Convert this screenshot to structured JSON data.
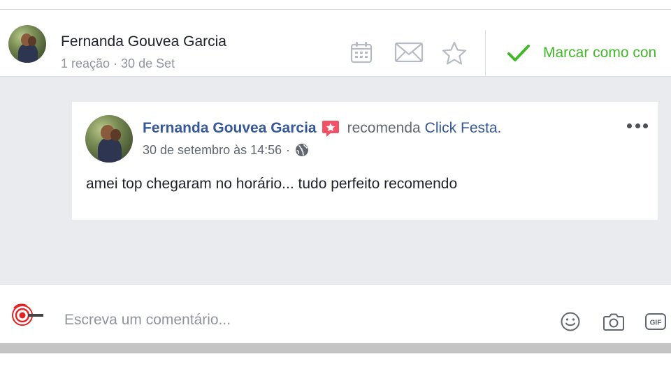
{
  "header": {
    "author_name": "Fernanda Gouvea Garcia",
    "meta": "1 reação · 30 de Set",
    "icons": [
      "calendar-icon",
      "envelope-icon",
      "star-icon"
    ],
    "mark_done_label": "Marcar como con"
  },
  "post": {
    "author_name": "Fernanda Gouvea Garcia",
    "badge_icon": "recommendation-star-icon",
    "verb": "recomenda",
    "page_name": "Click Festa.",
    "timestamp": "30 de setembro às 14:56",
    "separator": "·",
    "privacy_icon": "globe-icon",
    "text": "amei top chegaram no horário... tudo perfeito recomendo"
  },
  "comment": {
    "placeholder": "Escreva um comentário...",
    "icons": [
      "smiley-icon",
      "camera-icon",
      "gif-icon"
    ]
  },
  "colors": {
    "link_blue": "#365899",
    "success_green": "#42b72a",
    "badge_red": "#f25268",
    "background_gray": "#e9ebee"
  }
}
